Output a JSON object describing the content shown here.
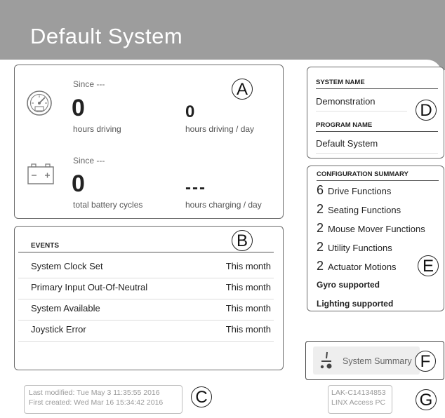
{
  "header": {
    "title": "Default System"
  },
  "usage": {
    "driving_since": "Since ---",
    "hours_driving_value": "0",
    "hours_driving_label": "hours driving",
    "hours_per_day_value": "0",
    "hours_per_day_label": "hours driving / day",
    "battery_since": "Since ---",
    "battery_cycles_value": "0",
    "battery_cycles_label": "total battery cycles",
    "charging_value": "---",
    "charging_label": "hours charging / day"
  },
  "events": {
    "header": "EVENTS",
    "rows": [
      {
        "name": "System Clock Set",
        "when": "This month"
      },
      {
        "name": "Primary Input Out-Of-Neutral",
        "when": "This month"
      },
      {
        "name": "System Available",
        "when": "This month"
      },
      {
        "name": "Joystick Error",
        "when": "This month"
      }
    ]
  },
  "system": {
    "system_name_header": "SYSTEM NAME",
    "system_name": "Demonstration",
    "program_name_header": "PROGRAM NAME",
    "program_name": "Default System"
  },
  "config": {
    "header": "CONFIGURATION SUMMARY",
    "items": [
      {
        "count": "6",
        "label": "Drive Functions"
      },
      {
        "count": "2",
        "label": "Seating Functions"
      },
      {
        "count": "2",
        "label": "Mouse Mover Functions"
      },
      {
        "count": "2",
        "label": "Utility Functions"
      },
      {
        "count": "2",
        "label": "Actuator Motions"
      }
    ],
    "gyro": "Gyro supported",
    "lighting": "Lighting supported"
  },
  "summary_button": {
    "label": "System Summary"
  },
  "meta": {
    "last_modified": "Last modified: Tue May 3 11:35:55 2016",
    "first_created": "First created: Wed Mar 16 15:34:42 2016"
  },
  "device": {
    "id": "LAK-C14134853",
    "connection": "LINX Access PC"
  },
  "callouts": {
    "a": "A",
    "b": "B",
    "c": "C",
    "d": "D",
    "e": "E",
    "f": "F",
    "g": "G"
  },
  "icons": {
    "speedometer": "speedometer-icon",
    "battery": "battery-icon",
    "summary": "wheelchair-icon"
  }
}
